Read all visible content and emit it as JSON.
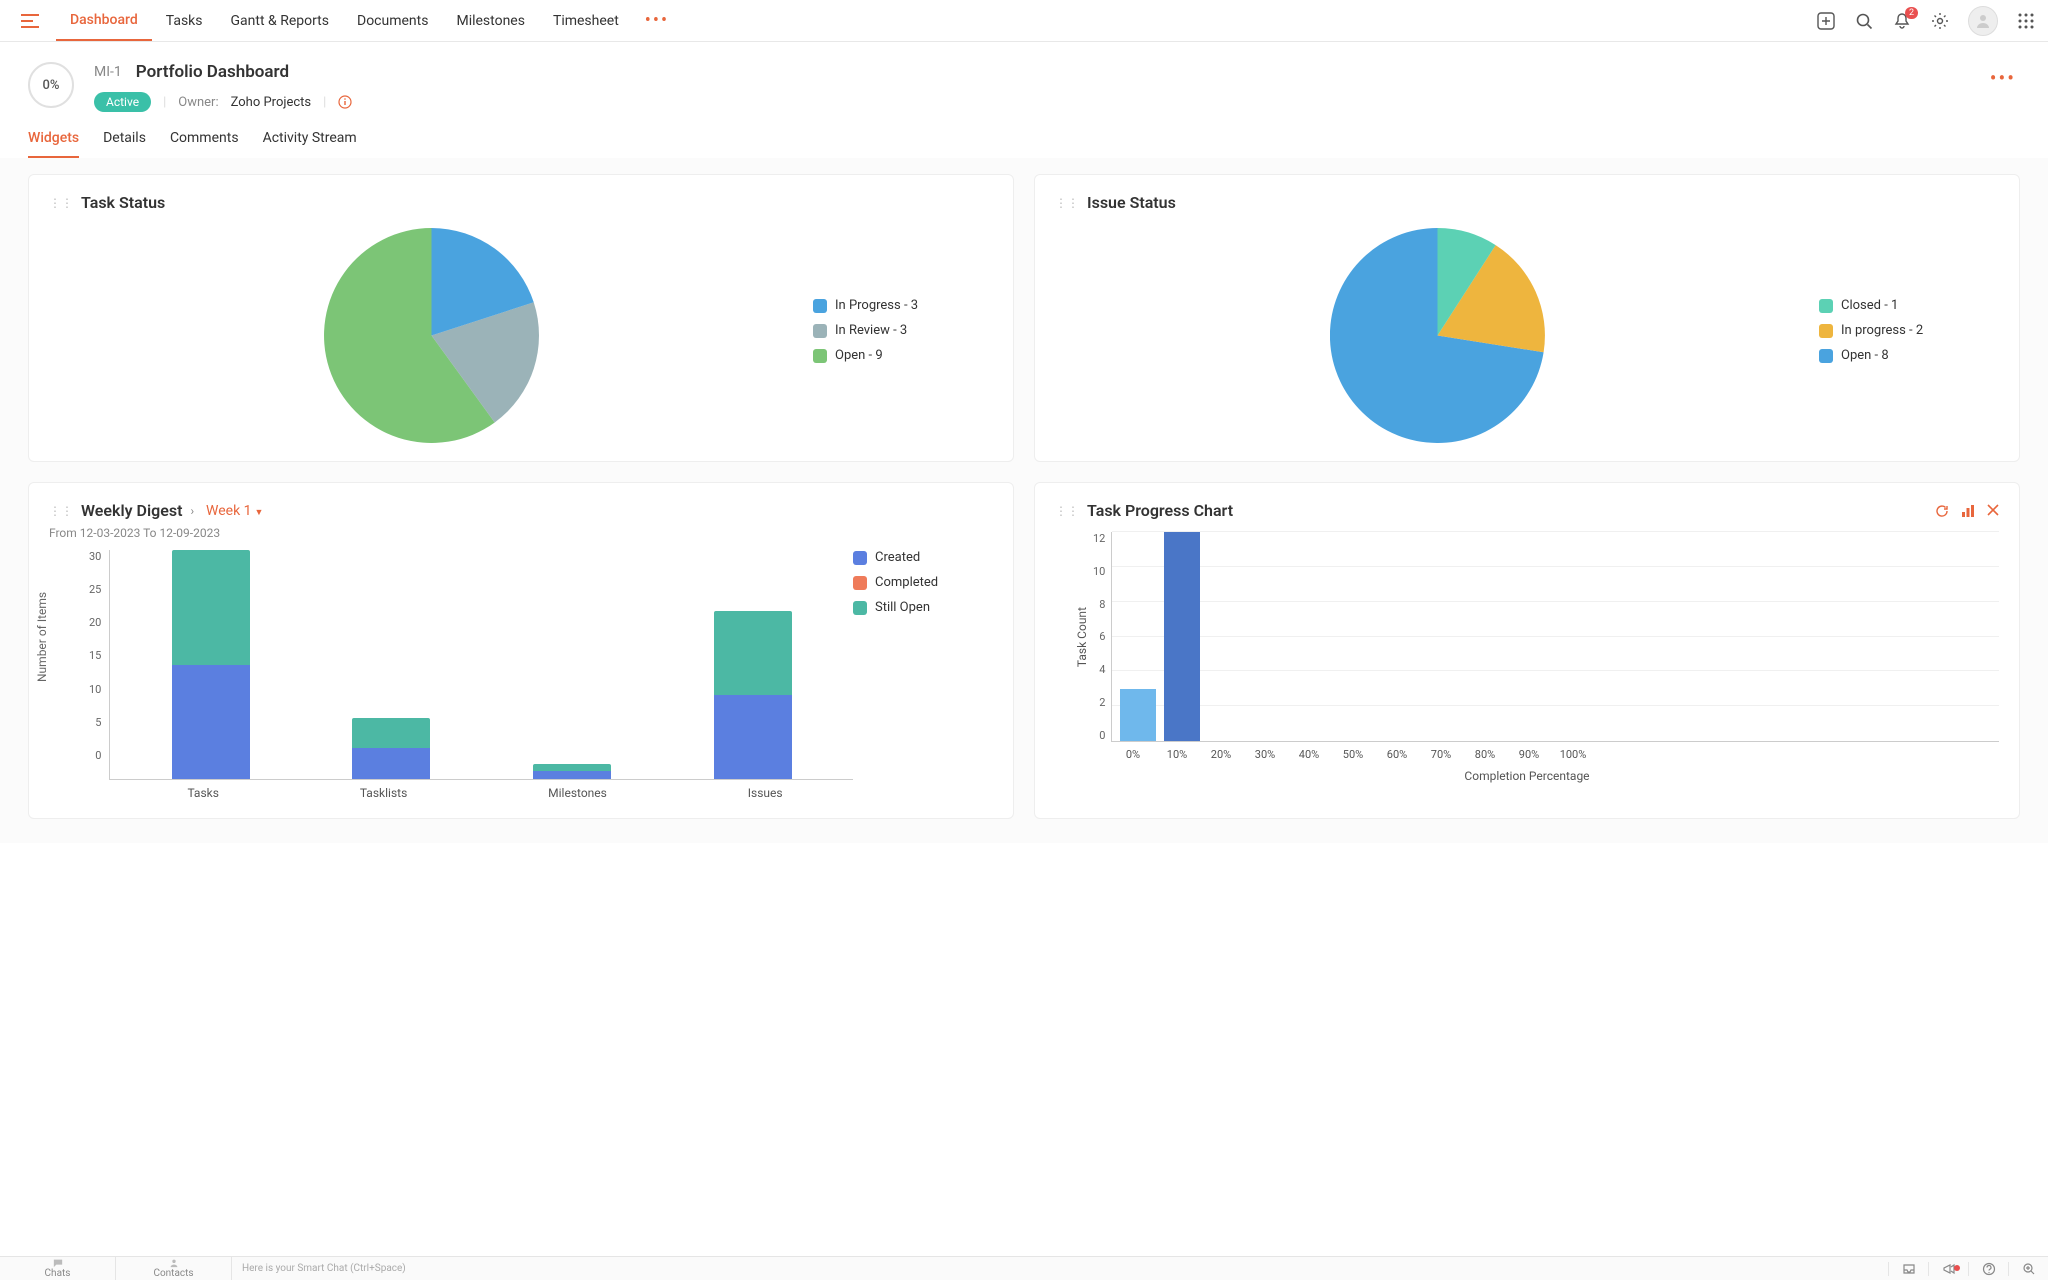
{
  "nav": {
    "tabs": [
      "Dashboard",
      "Tasks",
      "Gantt & Reports",
      "Documents",
      "Milestones",
      "Timesheet"
    ],
    "active_index": 0,
    "notification_count": "2"
  },
  "header": {
    "progress": "0%",
    "id": "MI-1",
    "title": "Portfolio Dashboard",
    "status": "Active",
    "owner_label": "Owner:",
    "owner_value": "Zoho Projects"
  },
  "subtabs": {
    "items": [
      "Widgets",
      "Details",
      "Comments",
      "Activity Stream"
    ],
    "active_index": 0
  },
  "widgets": {
    "task_status": {
      "title": "Task Status",
      "legend": [
        {
          "label": "In Progress - 3",
          "color": "#4aa3df"
        },
        {
          "label": "In Review - 3",
          "color": "#9bb3b8"
        },
        {
          "label": "Open - 9",
          "color": "#7cc576"
        }
      ]
    },
    "issue_status": {
      "title": "Issue Status",
      "legend": [
        {
          "label": "Closed - 1",
          "color": "#5cd1b4"
        },
        {
          "label": "In progress - 2",
          "color": "#eeb53e"
        },
        {
          "label": "Open - 8",
          "color": "#4aa3df"
        }
      ]
    },
    "weekly_digest": {
      "title": "Weekly Digest",
      "week_label": "Week 1",
      "date_range": "From 12-03-2023 To 12-09-2023",
      "y_label": "Number of Items",
      "y_ticks": [
        "30",
        "25",
        "20",
        "15",
        "10",
        "5",
        "0"
      ],
      "categories": [
        "Tasks",
        "Tasklists",
        "Milestones",
        "Issues"
      ],
      "legend": [
        {
          "label": "Created",
          "color": "#5b7fe0"
        },
        {
          "label": "Completed",
          "color": "#ef7b5a"
        },
        {
          "label": "Still Open",
          "color": "#4cb8a4"
        }
      ]
    },
    "task_progress": {
      "title": "Task Progress Chart",
      "y_label": "Task Count",
      "x_label": "Completion Percentage",
      "y_ticks": [
        "12",
        "10",
        "8",
        "6",
        "4",
        "2",
        "0"
      ],
      "x_ticks": [
        "0%",
        "10%",
        "20%",
        "30%",
        "40%",
        "50%",
        "60%",
        "70%",
        "80%",
        "90%",
        "100%"
      ]
    }
  },
  "bottom": {
    "chats": "Chats",
    "contacts": "Contacts",
    "smart_chat": "Here is your Smart Chat (Ctrl+Space)"
  },
  "chart_data": [
    {
      "type": "pie",
      "title": "Task Status",
      "series": [
        {
          "name": "In Progress",
          "value": 3
        },
        {
          "name": "In Review",
          "value": 3
        },
        {
          "name": "Open",
          "value": 9
        }
      ]
    },
    {
      "type": "pie",
      "title": "Issue Status",
      "series": [
        {
          "name": "Closed",
          "value": 1
        },
        {
          "name": "In progress",
          "value": 2
        },
        {
          "name": "Open",
          "value": 8
        }
      ]
    },
    {
      "type": "bar",
      "title": "Weekly Digest",
      "categories": [
        "Tasks",
        "Tasklists",
        "Milestones",
        "Issues"
      ],
      "series": [
        {
          "name": "Created",
          "values": [
            15,
            4,
            1,
            11
          ]
        },
        {
          "name": "Completed",
          "values": [
            0,
            0,
            0,
            0
          ]
        },
        {
          "name": "Still Open",
          "values": [
            15,
            4,
            1,
            11
          ]
        }
      ],
      "ylabel": "Number of Items",
      "ylim": [
        0,
        30
      ]
    },
    {
      "type": "bar",
      "title": "Task Progress Chart",
      "categories": [
        "0%",
        "10%",
        "20%",
        "30%",
        "40%",
        "50%",
        "60%",
        "70%",
        "80%",
        "90%",
        "100%"
      ],
      "values": [
        3,
        12,
        0,
        0,
        0,
        0,
        0,
        0,
        0,
        0,
        0
      ],
      "xlabel": "Completion Percentage",
      "ylabel": "Task Count",
      "ylim": [
        0,
        12
      ]
    }
  ]
}
